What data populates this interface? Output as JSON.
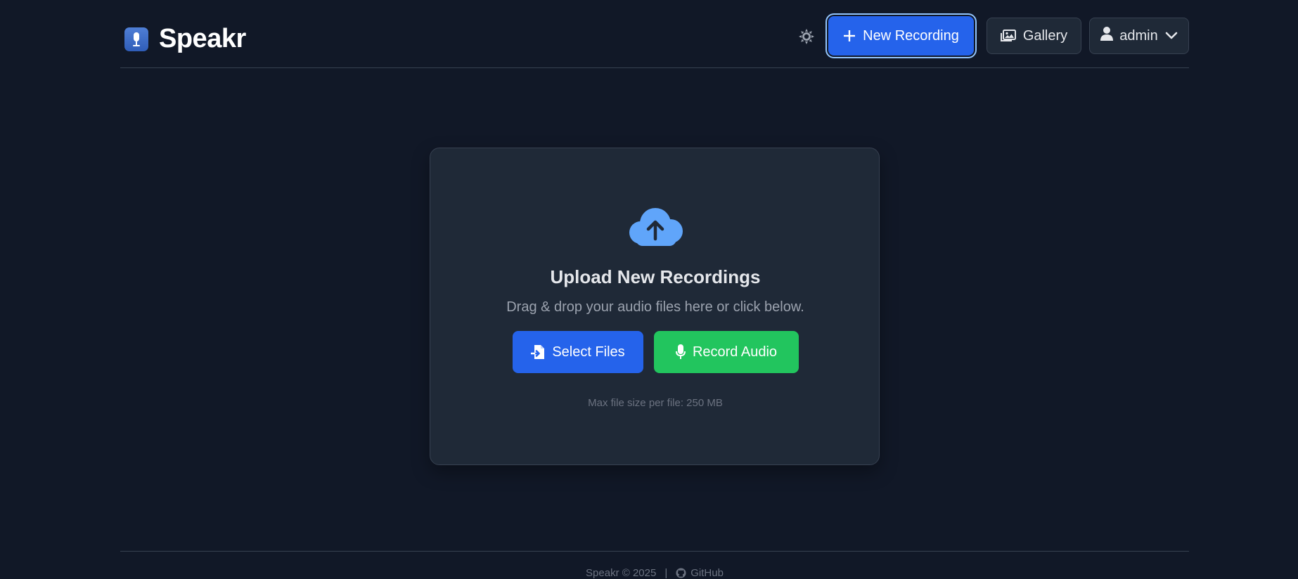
{
  "header": {
    "app_name": "Speakr",
    "new_recording_label": "New Recording",
    "gallery_label": "Gallery",
    "user_label": "admin"
  },
  "upload": {
    "title": "Upload New Recordings",
    "subtitle": "Drag & drop your audio files here or click below.",
    "select_files_label": "Select Files",
    "record_audio_label": "Record Audio",
    "note": "Max file size per file: 250 MB"
  },
  "footer": {
    "copyright": "Speakr © 2025",
    "separator": "|",
    "github_label": "GitHub"
  },
  "icons": {
    "logo": "microphone-icon",
    "theme": "sun-icon",
    "new": "plus-icon",
    "gallery": "images-icon",
    "user": "user-icon",
    "user_menu": "chevron-down-icon",
    "upload": "cloud-upload-icon",
    "select": "file-import-icon",
    "record": "microphone-icon",
    "github": "github-icon"
  },
  "colors": {
    "background": "#111827",
    "card": "#1f2937",
    "primary": "#2563eb",
    "success": "#22c55e",
    "cloud": "#60a5fa"
  }
}
